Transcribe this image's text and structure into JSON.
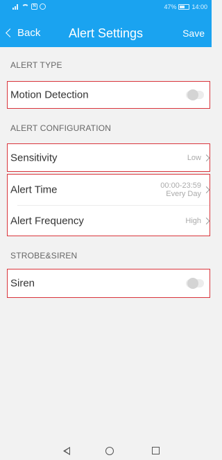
{
  "status": {
    "battery": "47%",
    "time": "14:00"
  },
  "nav": {
    "back_label": "Back",
    "title": "Alert Settings",
    "save_label": "Save"
  },
  "sections": {
    "alert_type": {
      "header": "ALERT TYPE",
      "motion_label": "Motion Detection"
    },
    "alert_config": {
      "header": "ALERT CONFIGURATION",
      "sensitivity_label": "Sensitivity",
      "sensitivity_value": "Low",
      "alert_time_label": "Alert Time",
      "alert_time_range": "00:00-23:59",
      "alert_time_days": "Every Day",
      "frequency_label": "Alert Frequency",
      "frequency_value": "High"
    },
    "strobe": {
      "header": "STROBE&SIREN",
      "siren_label": "Siren"
    }
  },
  "toggles": {
    "motion_detection": false,
    "siren": false
  },
  "icons": [
    "signal-icon",
    "wifi-icon",
    "nfc-icon",
    "alarm-icon",
    "battery-icon",
    "back-chevron-icon",
    "chevron-right-icon",
    "nav-back-icon",
    "nav-home-icon",
    "nav-recent-icon"
  ],
  "colors": {
    "primary": "#1aa3f0",
    "highlight": "#d9343b",
    "background": "#f2f2f2"
  }
}
